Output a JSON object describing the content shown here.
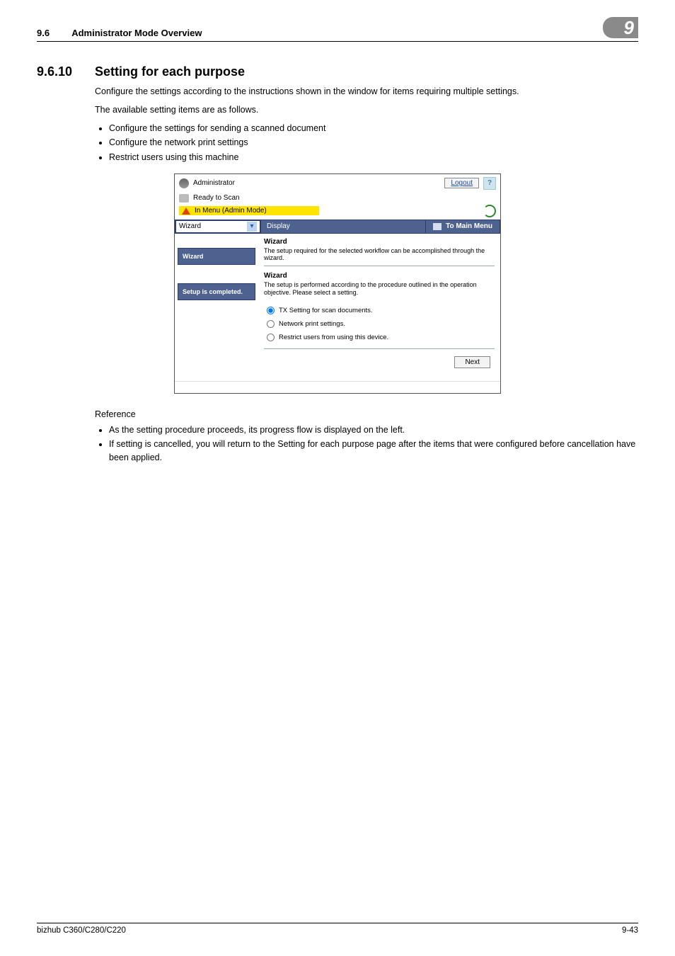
{
  "header": {
    "section_num": "9.6",
    "section_title": "Administrator Mode Overview",
    "chapter_badge": "9"
  },
  "section": {
    "num": "9.6.10",
    "title": "Setting for each purpose",
    "intro1": "Configure the settings according to the instructions shown in the window for items requiring multiple settings.",
    "intro2": "The available setting items are as follows.",
    "bullets": [
      "Configure the settings for sending a scanned document",
      "Configure the network print settings",
      "Restrict users using this machine"
    ]
  },
  "screenshot": {
    "top": {
      "admin_label": "Administrator",
      "logout": "Logout",
      "help": "?"
    },
    "status": {
      "ready": "Ready to Scan",
      "menu_warn": "In Menu (Admin Mode)"
    },
    "bar": {
      "select_value": "Wizard",
      "display": "Display",
      "main_menu": "To Main Menu"
    },
    "left": {
      "item1": "Wizard",
      "item2": "Setup is completed."
    },
    "right": {
      "head_title": "Wizard",
      "head_desc": "The setup required for the selected workflow can be accomplished through the wizard.",
      "sub_title": "Wizard",
      "sub_desc": "The setup is performed according to the procedure outlined in the operation objective. Please select a setting.",
      "opt1": "TX Setting for scan documents.",
      "opt2": "Network print settings.",
      "opt3": "Restrict users from using this device.",
      "next": "Next"
    }
  },
  "reference": {
    "title": "Reference",
    "bullets": [
      "As the setting procedure proceeds, its progress flow is displayed on the left.",
      "If setting is cancelled, you will return to the Setting for each purpose page after the items that were configured before cancellation have been applied."
    ]
  },
  "footer": {
    "left": "bizhub C360/C280/C220",
    "right": "9-43"
  }
}
